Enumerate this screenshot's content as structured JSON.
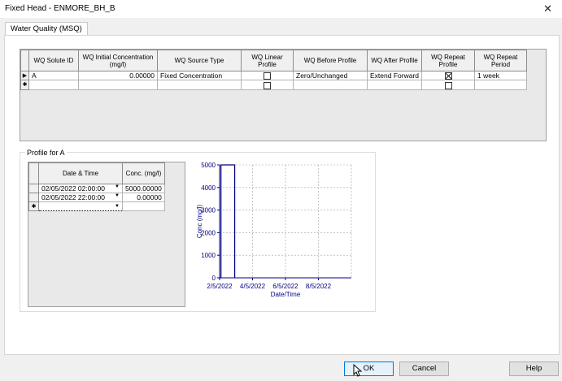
{
  "window": {
    "title": "Fixed Head - ENMORE_BH_B"
  },
  "tab": {
    "label": "Water Quality (MSQ)"
  },
  "wq_table": {
    "columns": [
      "WQ Solute ID",
      "WQ Initial Concentration (mg/l)",
      "WQ Source Type",
      "WQ Linear Profile",
      "WQ Before Profile",
      "WQ After Profile",
      "WQ Repeat Profile",
      "WQ Repeat Period"
    ],
    "row": {
      "solute_id": "A",
      "initial_conc": "0.00000",
      "source_type": "Fixed Concentration",
      "linear_profile": false,
      "before_profile": "Zero/Unchanged",
      "after_profile": "Extend Forward",
      "repeat_profile": true,
      "repeat_period": "1 week"
    },
    "new_row_marker": "✱",
    "current_row_marker": "▶"
  },
  "profile": {
    "group_label": "Profile for A",
    "columns": [
      "Date & Time",
      "Conc. (mg/l)"
    ],
    "rows": [
      {
        "date": "02/05/2022 02:00:00",
        "conc": "5000.00000"
      },
      {
        "date": "02/05/2022 22:00:00",
        "conc": "0.00000"
      }
    ]
  },
  "chart_data": {
    "type": "line",
    "xlabel": "Date/Time",
    "ylabel": "Conc (mg/l)",
    "x_ticks": [
      "2/5/2022",
      "4/5/2022",
      "6/5/2022",
      "8/5/2022"
    ],
    "y_ticks": [
      0,
      1000,
      2000,
      3000,
      4000,
      5000
    ],
    "ylim": [
      0,
      5000
    ],
    "series": [
      {
        "x": [
          "02/05/2022 02:00",
          "02/05/2022 02:00",
          "02/05/2022 22:00",
          "02/05/2022 22:00"
        ],
        "values": [
          0,
          5000,
          5000,
          0
        ]
      }
    ],
    "grid": true,
    "color": "#000080"
  },
  "buttons": {
    "ok": "OK",
    "cancel": "Cancel",
    "help": "Help"
  }
}
